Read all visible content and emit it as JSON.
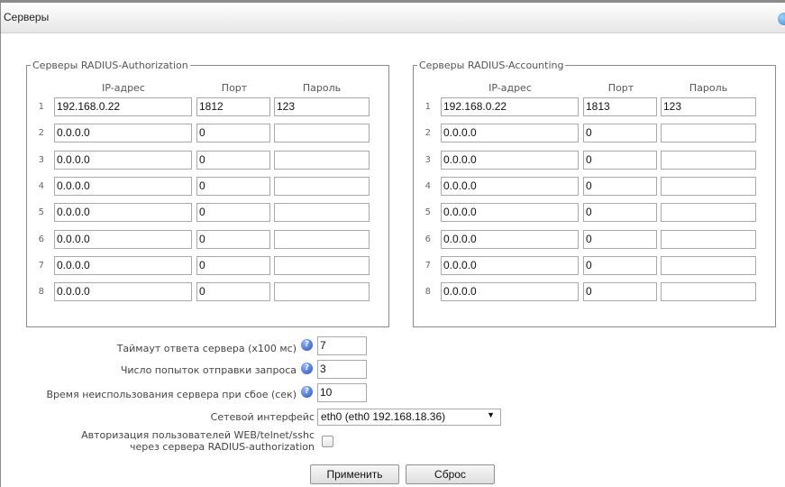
{
  "panel": {
    "title": "Серверы"
  },
  "auth": {
    "legend": "Серверы RADIUS-Authorization",
    "headers": {
      "ip": "IP-адрес",
      "port": "Порт",
      "password": "Пароль"
    },
    "rows": [
      {
        "num": "1",
        "ip": "192.168.0.22",
        "port": "1812",
        "password": "123"
      },
      {
        "num": "2",
        "ip": "0.0.0.0",
        "port": "0",
        "password": ""
      },
      {
        "num": "3",
        "ip": "0.0.0.0",
        "port": "0",
        "password": ""
      },
      {
        "num": "4",
        "ip": "0.0.0.0",
        "port": "0",
        "password": ""
      },
      {
        "num": "5",
        "ip": "0.0.0.0",
        "port": "0",
        "password": ""
      },
      {
        "num": "6",
        "ip": "0.0.0.0",
        "port": "0",
        "password": ""
      },
      {
        "num": "7",
        "ip": "0.0.0.0",
        "port": "0",
        "password": ""
      },
      {
        "num": "8",
        "ip": "0.0.0.0",
        "port": "0",
        "password": ""
      }
    ]
  },
  "acct": {
    "legend": "Серверы RADIUS-Accounting",
    "headers": {
      "ip": "IP-адрес",
      "port": "Порт",
      "password": "Пароль"
    },
    "rows": [
      {
        "num": "1",
        "ip": "192.168.0.22",
        "port": "1813",
        "password": "123"
      },
      {
        "num": "2",
        "ip": "0.0.0.0",
        "port": "0",
        "password": ""
      },
      {
        "num": "3",
        "ip": "0.0.0.0",
        "port": "0",
        "password": ""
      },
      {
        "num": "4",
        "ip": "0.0.0.0",
        "port": "0",
        "password": ""
      },
      {
        "num": "5",
        "ip": "0.0.0.0",
        "port": "0",
        "password": ""
      },
      {
        "num": "6",
        "ip": "0.0.0.0",
        "port": "0",
        "password": ""
      },
      {
        "num": "7",
        "ip": "0.0.0.0",
        "port": "0",
        "password": ""
      },
      {
        "num": "8",
        "ip": "0.0.0.0",
        "port": "0",
        "password": ""
      }
    ]
  },
  "settings": {
    "timeout_label": "Таймаут ответа сервера (x100 мс)",
    "timeout_value": "7",
    "retries_label": "Число попыток отправки запроса",
    "retries_value": "3",
    "deadtime_label": "Время неиспользования сервера при сбое (сек)",
    "deadtime_value": "10",
    "iface_label": "Сетевой интерфейс",
    "iface_value": "eth0 (eth0 192.168.18.36)",
    "auth_users_label_1": "Авторизация пользователей WEB/telnet/sshc",
    "auth_users_label_2": "через сервера RADIUS-authorization",
    "auth_users_checked": false
  },
  "buttons": {
    "apply": "Применить",
    "reset": "Сброс"
  },
  "icons": {
    "help": "help-icon",
    "corner": "info-icon",
    "dropdown": "chevron-down-icon"
  }
}
